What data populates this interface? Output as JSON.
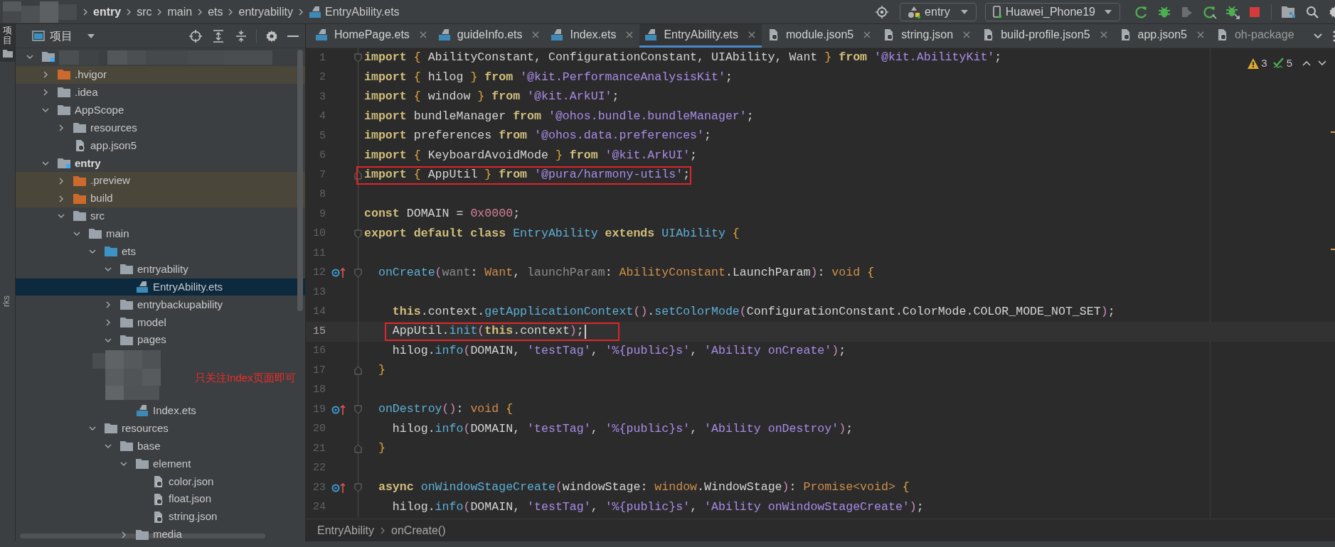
{
  "tool_strip": {
    "top_tab": "项目",
    "bottom_tab": "rks"
  },
  "breadcrumbs": [
    {
      "label": "entry",
      "kind": "module"
    },
    {
      "label": "src",
      "kind": "folder"
    },
    {
      "label": "main",
      "kind": "folder"
    },
    {
      "label": "ets",
      "kind": "folder"
    },
    {
      "label": "entryability",
      "kind": "folder"
    },
    {
      "label": "EntryAbility.ets",
      "kind": "ets"
    }
  ],
  "toolbar": {
    "module": "entry",
    "device": "Huawei_Phone19"
  },
  "project_panel": {
    "title": "项目",
    "tree": [
      {
        "kind": "root",
        "expanded": true,
        "selected": false,
        "children": [
          {
            "label": ".hvigor",
            "kind": "excluded",
            "expanded": false,
            "selected": false
          },
          {
            "label": ".idea",
            "kind": "folder",
            "expanded": false,
            "selected": false
          },
          {
            "label": "AppScope",
            "kind": "folder",
            "expanded": true,
            "selected": false,
            "children": [
              {
                "label": "resources",
                "kind": "folder",
                "expanded": false,
                "selected": false
              },
              {
                "label": "app.json5",
                "kind": "json",
                "selected": false
              }
            ]
          },
          {
            "label": "entry",
            "kind": "module",
            "expanded": true,
            "selected": false,
            "children": [
              {
                "label": ".preview",
                "kind": "excluded",
                "expanded": false,
                "selected": false
              },
              {
                "label": "build",
                "kind": "excluded",
                "expanded": false,
                "selected": false
              },
              {
                "label": "src",
                "kind": "folder",
                "expanded": true,
                "selected": false,
                "children": [
                  {
                    "label": "main",
                    "kind": "folder",
                    "expanded": true,
                    "selected": false,
                    "children": [
                      {
                        "label": "ets",
                        "kind": "source",
                        "expanded": true,
                        "selected": false,
                        "children": [
                          {
                            "label": "entryability",
                            "kind": "folder",
                            "expanded": true,
                            "selected": false,
                            "children": [
                              {
                                "label": "EntryAbility.ets",
                                "kind": "ets",
                                "selected": true
                              }
                            ]
                          },
                          {
                            "label": "entrybackupability",
                            "kind": "folder",
                            "expanded": false,
                            "selected": false
                          },
                          {
                            "label": "model",
                            "kind": "folder",
                            "expanded": false,
                            "selected": false
                          },
                          {
                            "label": "pages",
                            "kind": "folder",
                            "expanded": true,
                            "selected": false,
                            "children": [
                              {
                                "kind": "redacted"
                              },
                              {
                                "label": "Index.ets",
                                "kind": "ets",
                                "selected": false
                              }
                            ]
                          }
                        ]
                      },
                      {
                        "label": "resources",
                        "kind": "folder",
                        "expanded": true,
                        "selected": false,
                        "children": [
                          {
                            "label": "base",
                            "kind": "folder",
                            "expanded": true,
                            "selected": false,
                            "children": [
                              {
                                "label": "element",
                                "kind": "folder",
                                "expanded": true,
                                "selected": false,
                                "children": [
                                  {
                                    "label": "color.json",
                                    "kind": "json",
                                    "selected": false
                                  },
                                  {
                                    "label": "float.json",
                                    "kind": "json",
                                    "selected": false
                                  },
                                  {
                                    "label": "string.json",
                                    "kind": "json",
                                    "selected": false
                                  }
                                ]
                              },
                              {
                                "label": "media",
                                "kind": "folder",
                                "expanded": false,
                                "selected": false
                              }
                            ]
                          }
                        ]
                      }
                    ]
                  }
                ]
              }
            ]
          }
        ]
      }
    ]
  },
  "annotation": {
    "text": "只关注Index页面即可"
  },
  "tabs": [
    {
      "label": "HomePage.ets",
      "kind": "ets",
      "selected": false,
      "truncated": false
    },
    {
      "label": "guideInfo.ets",
      "kind": "ets",
      "selected": false,
      "truncated": false
    },
    {
      "label": "Index.ets",
      "kind": "ets",
      "selected": false,
      "truncated": false
    },
    {
      "label": "EntryAbility.ets",
      "kind": "ets",
      "selected": true,
      "truncated": false
    },
    {
      "label": "module.json5",
      "kind": "json",
      "selected": false,
      "truncated": false
    },
    {
      "label": "string.json",
      "kind": "json",
      "selected": false,
      "truncated": false
    },
    {
      "label": "build-profile.json5",
      "kind": "json",
      "selected": false,
      "truncated": false
    },
    {
      "label": "app.json5",
      "kind": "json",
      "selected": false,
      "truncated": false
    },
    {
      "label": "oh-package",
      "kind": "json",
      "selected": false,
      "truncated": true
    }
  ],
  "editor": {
    "inspections": {
      "warnings": "3",
      "passed": "5"
    },
    "lines": [
      {
        "number": "1",
        "fold": {
          "kind": "start"
        },
        "current": false,
        "boxed": false,
        "tokens": [
          {
            "kind": "kw",
            "text": "import "
          },
          {
            "kind": "brace",
            "text": "{"
          },
          {
            "kind": "plain",
            "text": " AbilityConstant, ConfigurationConstant, UIAbility, Want "
          },
          {
            "kind": "brace",
            "text": "}"
          },
          {
            "kind": "kw",
            "text": " from "
          },
          {
            "kind": "str",
            "text": "'@kit.AbilityKit'"
          },
          {
            "kind": "plain",
            "text": ";"
          }
        ]
      },
      {
        "number": "2",
        "current": false,
        "boxed": false,
        "tokens": [
          {
            "kind": "kw",
            "text": "import "
          },
          {
            "kind": "brace",
            "text": "{"
          },
          {
            "kind": "plain",
            "text": " hilog "
          },
          {
            "kind": "brace",
            "text": "}"
          },
          {
            "kind": "kw",
            "text": " from "
          },
          {
            "kind": "str",
            "text": "'@kit.PerformanceAnalysisKit'"
          },
          {
            "kind": "plain",
            "text": ";"
          }
        ]
      },
      {
        "number": "3",
        "current": false,
        "boxed": false,
        "tokens": [
          {
            "kind": "kw",
            "text": "import "
          },
          {
            "kind": "brace",
            "text": "{"
          },
          {
            "kind": "plain",
            "text": " window "
          },
          {
            "kind": "brace",
            "text": "}"
          },
          {
            "kind": "kw",
            "text": " from "
          },
          {
            "kind": "str",
            "text": "'@kit.ArkUI'"
          },
          {
            "kind": "plain",
            "text": ";"
          }
        ]
      },
      {
        "number": "4",
        "current": false,
        "boxed": false,
        "tokens": [
          {
            "kind": "kw",
            "text": "import "
          },
          {
            "kind": "plain",
            "text": "bundleManager "
          },
          {
            "kind": "kw",
            "text": "from "
          },
          {
            "kind": "str",
            "text": "'@ohos.bundle.bundleManager'"
          },
          {
            "kind": "plain",
            "text": ";"
          }
        ]
      },
      {
        "number": "5",
        "current": false,
        "boxed": false,
        "tokens": [
          {
            "kind": "kw",
            "text": "import "
          },
          {
            "kind": "plain",
            "text": "preferences "
          },
          {
            "kind": "kw",
            "text": "from "
          },
          {
            "kind": "str",
            "text": "'@ohos.data.preferences'"
          },
          {
            "kind": "plain",
            "text": ";"
          }
        ]
      },
      {
        "number": "6",
        "current": false,
        "boxed": false,
        "tokens": [
          {
            "kind": "kw",
            "text": "import "
          },
          {
            "kind": "brace",
            "text": "{"
          },
          {
            "kind": "plain",
            "text": " KeyboardAvoidMode "
          },
          {
            "kind": "brace",
            "text": "}"
          },
          {
            "kind": "kw",
            "text": " from "
          },
          {
            "kind": "str",
            "text": "'@kit.ArkUI'"
          },
          {
            "kind": "plain",
            "text": ";"
          }
        ]
      },
      {
        "number": "7",
        "fold": {
          "kind": "end"
        },
        "current": false,
        "boxed": true,
        "tokens": [
          {
            "kind": "kw",
            "text": "import "
          },
          {
            "kind": "brace",
            "text": "{"
          },
          {
            "kind": "plain",
            "text": " AppUtil "
          },
          {
            "kind": "brace",
            "text": "}"
          },
          {
            "kind": "kw",
            "text": " from "
          },
          {
            "kind": "str",
            "text": "'@pura/harmony-utils'"
          },
          {
            "kind": "plain",
            "text": ";"
          }
        ]
      },
      {
        "number": "8",
        "current": false
      },
      {
        "number": "9",
        "current": false,
        "boxed": false,
        "tokens": [
          {
            "kind": "kw",
            "text": "const "
          },
          {
            "kind": "plain",
            "text": "DOMAIN = "
          },
          {
            "kind": "num",
            "text": "0x0000"
          },
          {
            "kind": "plain",
            "text": ";"
          }
        ]
      },
      {
        "number": "10",
        "fold": {
          "kind": "start"
        },
        "current": false,
        "boxed": false,
        "tokens": [
          {
            "kind": "kw",
            "text": "export default class "
          },
          {
            "kind": "fn",
            "text": "EntryAbility"
          },
          {
            "kind": "kw",
            "text": " extends "
          },
          {
            "kind": "fn",
            "text": "UIAbility"
          },
          {
            "kind": "brace",
            "text": " {"
          }
        ]
      },
      {
        "number": "11",
        "current": false
      },
      {
        "number": "12",
        "fold": {
          "kind": "start"
        },
        "marker": {
          "kind": "override"
        },
        "current": false,
        "boxed": false,
        "tokens": [
          {
            "kind": "fn",
            "text": "  onCreate"
          },
          {
            "kind": "paren",
            "text": "("
          },
          {
            "kind": "param",
            "text": "want"
          },
          {
            "kind": "plain",
            "text": ": "
          },
          {
            "kind": "type",
            "text": "Want"
          },
          {
            "kind": "plain",
            "text": ", "
          },
          {
            "kind": "param",
            "text": "launchParam"
          },
          {
            "kind": "plain",
            "text": ": "
          },
          {
            "kind": "type",
            "text": "AbilityConstant"
          },
          {
            "kind": "plain",
            "text": ".LaunchParam"
          },
          {
            "kind": "paren",
            "text": ")"
          },
          {
            "kind": "plain",
            "text": ": "
          },
          {
            "kind": "type",
            "text": "void"
          },
          {
            "kind": "brace",
            "text": " {"
          }
        ]
      },
      {
        "number": "13",
        "current": false
      },
      {
        "number": "14",
        "current": false,
        "boxed": false,
        "tokens": [
          {
            "kind": "kw",
            "text": "    this"
          },
          {
            "kind": "plain",
            "text": ".context."
          },
          {
            "kind": "fn",
            "text": "getApplicationContext"
          },
          {
            "kind": "paren",
            "text": "()"
          },
          {
            "kind": "plain",
            "text": "."
          },
          {
            "kind": "fn",
            "text": "setColorMode"
          },
          {
            "kind": "paren",
            "text": "("
          },
          {
            "kind": "plain",
            "text": "ConfigurationConstant.ColorMode.COLOR_MODE_NOT_SET"
          },
          {
            "kind": "paren",
            "text": ")"
          },
          {
            "kind": "plain",
            "text": ";"
          }
        ]
      },
      {
        "number": "15",
        "current": true,
        "boxed": true,
        "tokens": [
          {
            "kind": "plain",
            "text": "    AppUtil."
          },
          {
            "kind": "fn",
            "text": "init"
          },
          {
            "kind": "paren",
            "text": "("
          },
          {
            "kind": "kw",
            "text": "this"
          },
          {
            "kind": "plain",
            "text": ".context"
          },
          {
            "kind": "paren",
            "text": ")"
          },
          {
            "kind": "plain",
            "text": ";"
          }
        ]
      },
      {
        "number": "16",
        "current": false,
        "boxed": false,
        "tokens": [
          {
            "kind": "plain",
            "text": "    hilog."
          },
          {
            "kind": "fn",
            "text": "info"
          },
          {
            "kind": "paren",
            "text": "("
          },
          {
            "kind": "plain",
            "text": "DOMAIN, "
          },
          {
            "kind": "str",
            "text": "'testTag'"
          },
          {
            "kind": "plain",
            "text": ", "
          },
          {
            "kind": "str",
            "text": "'%{public}s'"
          },
          {
            "kind": "plain",
            "text": ", "
          },
          {
            "kind": "str",
            "text": "'Ability onCreate'"
          },
          {
            "kind": "paren",
            "text": ")"
          },
          {
            "kind": "plain",
            "text": ";"
          }
        ]
      },
      {
        "number": "17",
        "fold": {
          "kind": "end"
        },
        "current": false,
        "boxed": false,
        "tokens": [
          {
            "kind": "brace",
            "text": "  }"
          }
        ]
      },
      {
        "number": "18",
        "current": false
      },
      {
        "number": "19",
        "fold": {
          "kind": "start"
        },
        "marker": {
          "kind": "override"
        },
        "current": false,
        "boxed": false,
        "tokens": [
          {
            "kind": "fn",
            "text": "  onDestroy"
          },
          {
            "kind": "paren",
            "text": "()"
          },
          {
            "kind": "plain",
            "text": ": "
          },
          {
            "kind": "type",
            "text": "void"
          },
          {
            "kind": "brace",
            "text": " {"
          }
        ]
      },
      {
        "number": "20",
        "current": false,
        "boxed": false,
        "tokens": [
          {
            "kind": "plain",
            "text": "    hilog."
          },
          {
            "kind": "fn",
            "text": "info"
          },
          {
            "kind": "paren",
            "text": "("
          },
          {
            "kind": "plain",
            "text": "DOMAIN, "
          },
          {
            "kind": "str",
            "text": "'testTag'"
          },
          {
            "kind": "plain",
            "text": ", "
          },
          {
            "kind": "str",
            "text": "'%{public}s'"
          },
          {
            "kind": "plain",
            "text": ", "
          },
          {
            "kind": "str",
            "text": "'Ability onDestroy'"
          },
          {
            "kind": "paren",
            "text": ")"
          },
          {
            "kind": "plain",
            "text": ";"
          }
        ]
      },
      {
        "number": "21",
        "fold": {
          "kind": "end"
        },
        "current": false,
        "boxed": false,
        "tokens": [
          {
            "kind": "brace",
            "text": "  }"
          }
        ]
      },
      {
        "number": "22",
        "current": false
      },
      {
        "number": "23",
        "fold": {
          "kind": "start"
        },
        "marker": {
          "kind": "override"
        },
        "current": false,
        "boxed": false,
        "tokens": [
          {
            "kind": "kw",
            "text": "  async "
          },
          {
            "kind": "fn",
            "text": "onWindowStageCreate"
          },
          {
            "kind": "paren",
            "text": "("
          },
          {
            "kind": "plain",
            "text": "windowStage: "
          },
          {
            "kind": "type",
            "text": "window"
          },
          {
            "kind": "plain",
            "text": ".WindowStage"
          },
          {
            "kind": "paren",
            "text": ")"
          },
          {
            "kind": "plain",
            "text": ": "
          },
          {
            "kind": "type",
            "text": "Promise<void>"
          },
          {
            "kind": "brace",
            "text": " {"
          }
        ]
      },
      {
        "number": "24",
        "current": false,
        "boxed": false,
        "tokens": [
          {
            "kind": "plain",
            "text": "    hilog."
          },
          {
            "kind": "fn",
            "text": "info"
          },
          {
            "kind": "paren",
            "text": "("
          },
          {
            "kind": "plain",
            "text": "DOMAIN, "
          },
          {
            "kind": "str",
            "text": "'testTag'"
          },
          {
            "kind": "plain",
            "text": ", "
          },
          {
            "kind": "str",
            "text": "'%{public}s'"
          },
          {
            "kind": "plain",
            "text": ", "
          },
          {
            "kind": "str",
            "text": "'Ability onWindowStageCreate'"
          },
          {
            "kind": "paren",
            "text": ")"
          },
          {
            "kind": "plain",
            "text": ";"
          }
        ]
      }
    ]
  },
  "editor_breadcrumbs": [
    "EntryAbility",
    "onCreate()"
  ]
}
